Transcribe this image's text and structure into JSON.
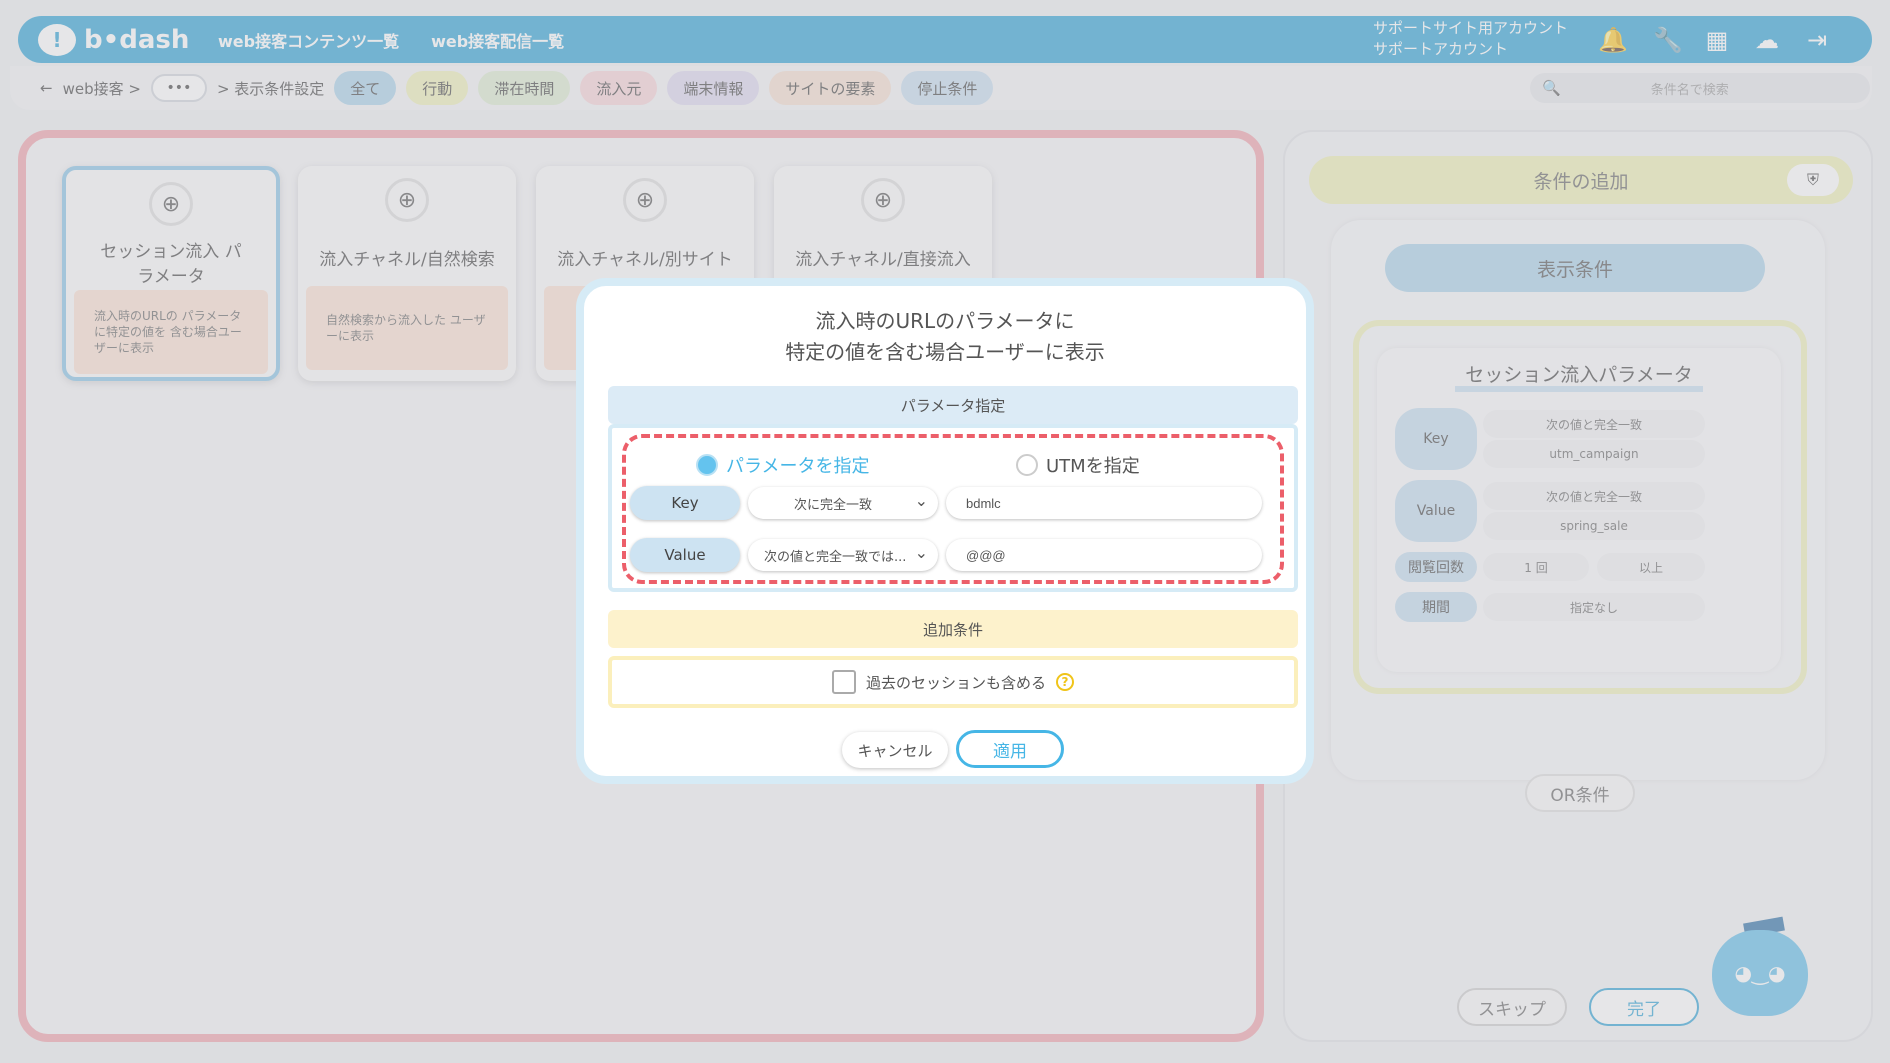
{
  "header": {
    "logo": "b•dash",
    "nav": [
      "web接客コンテンツ一覧",
      "web接客配信一覧"
    ],
    "account_line1": "サポートサイト用アカウント",
    "account_line2": "サポートアカウント",
    "icons": [
      "bell-icon",
      "wrench-icon",
      "grid-icon",
      "cloud-icon",
      "logout-icon"
    ]
  },
  "breadcrumb": {
    "back": "←",
    "item1": "web接客 >",
    "dots": "•••",
    "item2": "> 表示条件設定",
    "tabs": [
      {
        "label": "全て",
        "color": "#a9d1ea"
      },
      {
        "label": "行動",
        "color": "#eef0b8"
      },
      {
        "label": "滞在時間",
        "color": "#dceccf"
      },
      {
        "label": "流入元",
        "color": "#f7d3d8"
      },
      {
        "label": "端末情報",
        "color": "#ddd8ee"
      },
      {
        "label": "サイトの要素",
        "color": "#f6dfcf"
      },
      {
        "label": "停止条件",
        "color": "#c6dcee"
      }
    ],
    "search_placeholder": "条件名で検索"
  },
  "cards": [
    {
      "title": "セッション流入 パラメータ",
      "desc": "流入時のURLの パラメータに特定の値を 含む場合ユーザーに表示"
    },
    {
      "title": "流入チャネル/自然検索",
      "desc": "自然検索から流入した ユーザーに表示"
    },
    {
      "title": "流入チャネル/別サイト",
      "desc": ""
    },
    {
      "title": "流入チャネル/直接流入",
      "desc": ""
    }
  ],
  "right": {
    "add_condition": "条件の追加",
    "display_condition": "表示条件",
    "session_title": "セッション流入パラメータ",
    "key_label": "Key",
    "key_match": "次の値と完全一致",
    "key_value": "utm_campaign",
    "value_label": "Value",
    "value_match": "次の値と完全一致",
    "value_value": "spring_sale",
    "views_label": "閲覧回数",
    "views_count": "1 回",
    "views_op": "以上",
    "period_label": "期間",
    "period_value": "指定なし",
    "or_button": "OR条件",
    "skip_button": "スキップ",
    "done_button": "完了"
  },
  "modal": {
    "title_line1": "流入時のURLのパラメータに",
    "title_line2": "特定の値を含む場合ユーザーに表示",
    "param_header": "パラメータ指定",
    "radio_param": "パラメータを指定",
    "radio_utm": "UTMを指定",
    "key_label": "Key",
    "key_select": "次に完全一致",
    "key_input": "bdmlc",
    "value_label": "Value",
    "value_select": "次の値と完全一致では...",
    "value_input": "@@@",
    "extra_header": "追加条件",
    "past_sessions": "過去のセッションも含める",
    "help": "?",
    "cancel": "キャンセル",
    "apply": "適用"
  }
}
